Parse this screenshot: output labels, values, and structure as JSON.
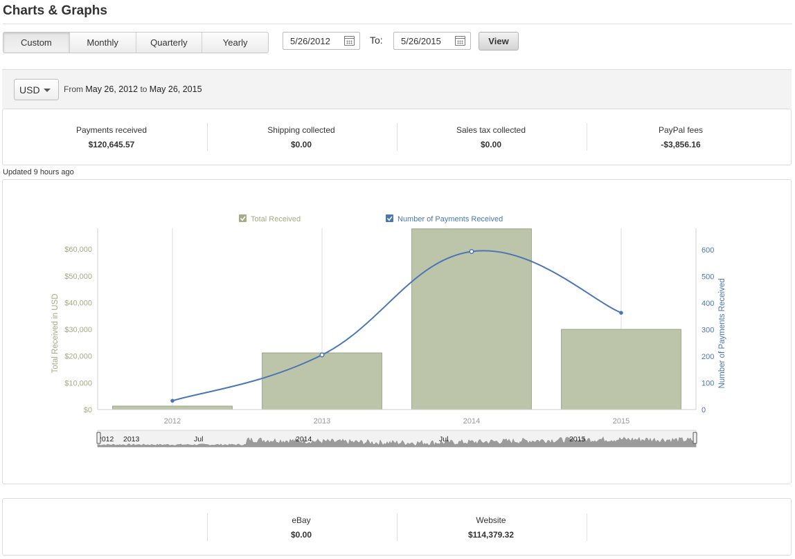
{
  "page": {
    "title": "Charts & Graphs"
  },
  "period_tabs": [
    {
      "label": "Custom",
      "active": true
    },
    {
      "label": "Monthly",
      "active": false
    },
    {
      "label": "Quarterly",
      "active": false
    },
    {
      "label": "Yearly",
      "active": false
    }
  ],
  "date_range": {
    "from_value": "5/26/2012",
    "to_label": "To:",
    "to_value": "5/26/2015",
    "view_label": "View"
  },
  "filter": {
    "currency": "USD",
    "from_word": "From",
    "from_date": "May 26, 2012",
    "to_word": "to",
    "to_date": "May 26, 2015"
  },
  "summary": [
    {
      "label": "Payments received",
      "value": "$120,645.57"
    },
    {
      "label": "Shipping collected",
      "value": "$0.00"
    },
    {
      "label": "Sales tax collected",
      "value": "$0.00"
    },
    {
      "label": "PayPal fees",
      "value": "-$3,856.16"
    }
  ],
  "updated_text": "Updated 9 hours ago",
  "sources": [
    {
      "label": "eBay",
      "value": "$0.00"
    },
    {
      "label": "Website",
      "value": "$114,379.32"
    }
  ],
  "colors": {
    "bar": "#bcc5a9",
    "bar_border": "#9aa584",
    "line": "#4a76b4",
    "left_axis": "#a4ab86",
    "right_axis": "#4a76b4"
  },
  "chart_data": {
    "type": "bar",
    "categories": [
      "2012",
      "2013",
      "2014",
      "2015"
    ],
    "legend": [
      {
        "label": "Total Received",
        "checked": true
      },
      {
        "label": "Number of Payments Received",
        "checked": true
      }
    ],
    "legend_position": "top",
    "series": [
      {
        "name": "Total Received",
        "type": "bar",
        "axis": "left",
        "values": [
          1300,
          21200,
          67600,
          30000
        ]
      },
      {
        "name": "Number of Payments Received",
        "type": "line",
        "axis": "right",
        "values": [
          33,
          205,
          593,
          363
        ]
      }
    ],
    "ylabel": "Total Received in USD",
    "y2label": "Number of Payments Received",
    "ylim": [
      0,
      67800
    ],
    "y2lim": [
      0,
      680
    ],
    "yticks": [
      0,
      10000,
      20000,
      30000,
      40000,
      50000,
      60000
    ],
    "ytick_labels": [
      "$0",
      "$10,000",
      "$20,000",
      "$30,000",
      "$40,000",
      "$50,000",
      "$60,000"
    ],
    "y2ticks": [
      0,
      100,
      200,
      300,
      400,
      500,
      600
    ],
    "y2tick_labels": [
      "0",
      "100",
      "200",
      "300",
      "400",
      "500",
      "600"
    ],
    "grid": "vertical",
    "navigator_labels": [
      "2012",
      "2013",
      "Jul",
      "2014",
      "Jul",
      "2015"
    ]
  }
}
